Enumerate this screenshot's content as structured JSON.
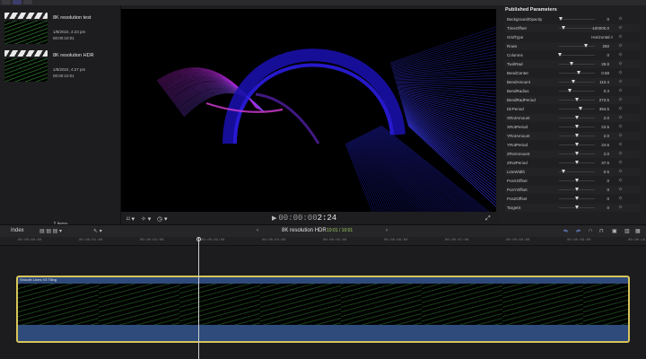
{
  "browser": {
    "clips": [
      {
        "title": "8K resolution test",
        "date": "1/8/2022, 4:23 pm",
        "duration": "00:00:10:01"
      },
      {
        "title": "8K resolution HDR",
        "date": "1/8/2022, 4:27 pm",
        "duration": "00:00:10:01"
      }
    ],
    "items_count": "2 items"
  },
  "viewer": {
    "timecode_dim": "00:00:00",
    "timecode_bright": "2:24"
  },
  "inspector": {
    "title": "Published Parameters",
    "params": [
      {
        "label": "BackgroundOpacity",
        "value": "0",
        "slider": 0.05
      },
      {
        "label": "TimeOffset",
        "value": "100000.0",
        "slider": 0.12
      },
      {
        "label": "GridType",
        "value": "Horizontal ◊",
        "slider": null
      },
      {
        "label": "Rows",
        "value": "250",
        "slider": 0.75
      },
      {
        "label": "Columns",
        "value": "0",
        "slider": 0.02
      },
      {
        "label": "TwirlRad",
        "value": "28.8",
        "slider": 0.35
      },
      {
        "label": "BendCenter",
        "value": "0.68",
        "slider": 0.55
      },
      {
        "label": "BendAmount",
        "value": "110.4",
        "slider": 0.4
      },
      {
        "label": "BendRadius",
        "value": "0.3",
        "slider": 0.3
      },
      {
        "label": "BendRadPeriod",
        "value": "273.5",
        "slider": 0.5
      },
      {
        "label": "DirPeriod",
        "value": "394.5",
        "slider": 0.6
      },
      {
        "label": "XRotAmount",
        "value": "2.0",
        "slider": 0.5
      },
      {
        "label": "XRotPeriod",
        "value": "23.5",
        "slider": 0.5
      },
      {
        "label": "YRotAmount",
        "value": "2.0",
        "slider": 0.5
      },
      {
        "label": "YRotPeriod",
        "value": "24.6",
        "slider": 0.5
      },
      {
        "label": "ZRotAmount",
        "value": "2.0",
        "slider": 0.5
      },
      {
        "label": "ZRotPeriod",
        "value": "37.5",
        "slider": 0.5
      },
      {
        "label": "LineWidth",
        "value": "0.5",
        "slider": 0.12
      },
      {
        "label": "PosXOffset",
        "value": "0",
        "slider": 0.5
      },
      {
        "label": "PosYOffset",
        "value": "0",
        "slider": 0.5
      },
      {
        "label": "PosZOffset",
        "value": "0",
        "slider": 0.5
      },
      {
        "label": "TargetX",
        "value": "0",
        "slider": 0.5
      }
    ]
  },
  "timeline": {
    "index_label": "Index",
    "project_name": "8K resolution HDR",
    "project_duration": "10:01 / 10:01",
    "clip_name": "Smooth Lines V3 Tiling"
  }
}
